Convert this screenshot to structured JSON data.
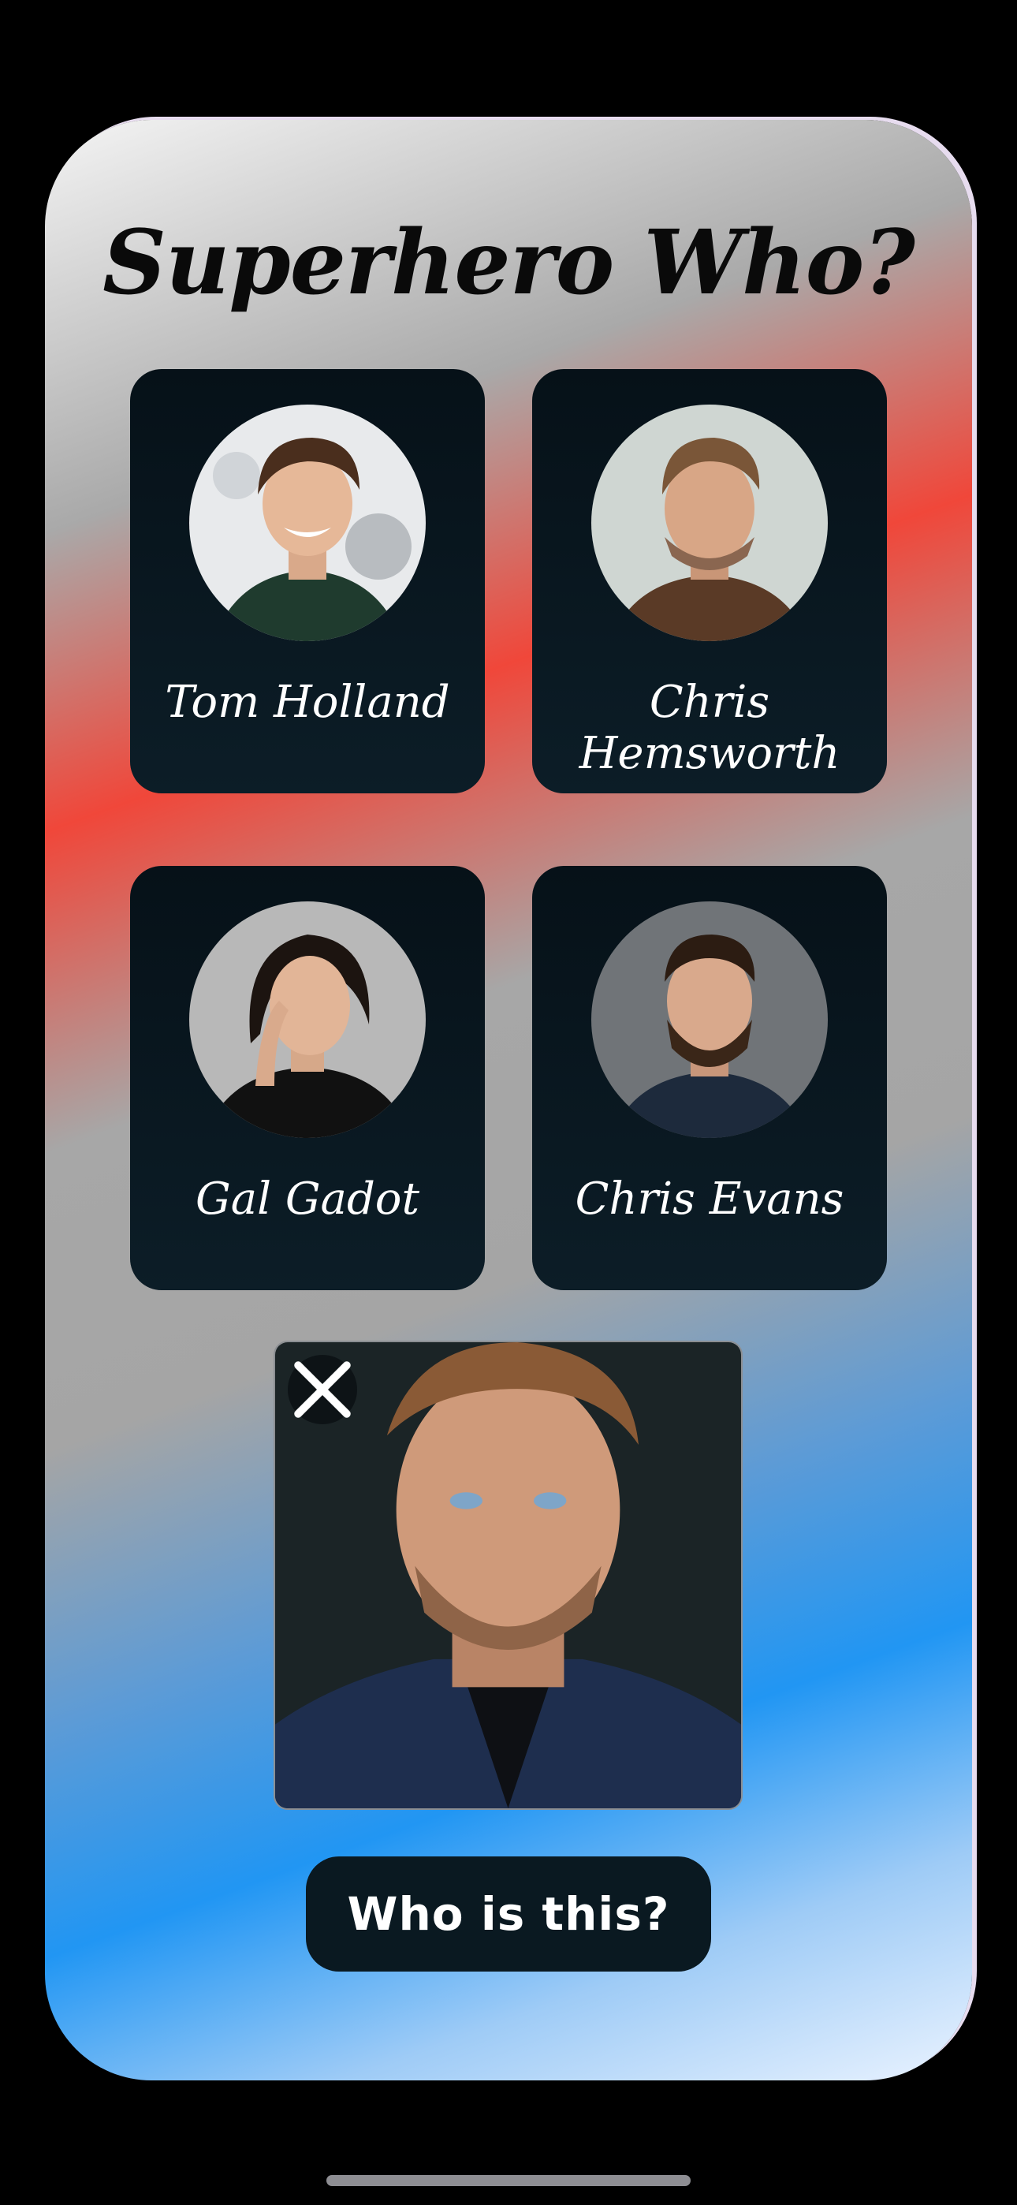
{
  "app": {
    "title": "Superhero Who?"
  },
  "heroes": [
    {
      "name": "Tom Holland",
      "photo_icon": "actor-portrait"
    },
    {
      "name": "Chris Hemsworth",
      "photo_icon": "actor-portrait"
    },
    {
      "name": "Gal Gadot",
      "photo_icon": "actor-portrait"
    },
    {
      "name": "Chris Evans",
      "photo_icon": "actor-portrait"
    }
  ],
  "reveal": {
    "close_icon": "close-icon",
    "photo_icon": "mystery-portrait"
  },
  "actions": {
    "ask_label": "Who is this?"
  },
  "colors": {
    "card_bg": "#071219",
    "button_bg": "#0a1921",
    "gradient_red": "#f0473a",
    "gradient_blue": "#2196f3"
  }
}
